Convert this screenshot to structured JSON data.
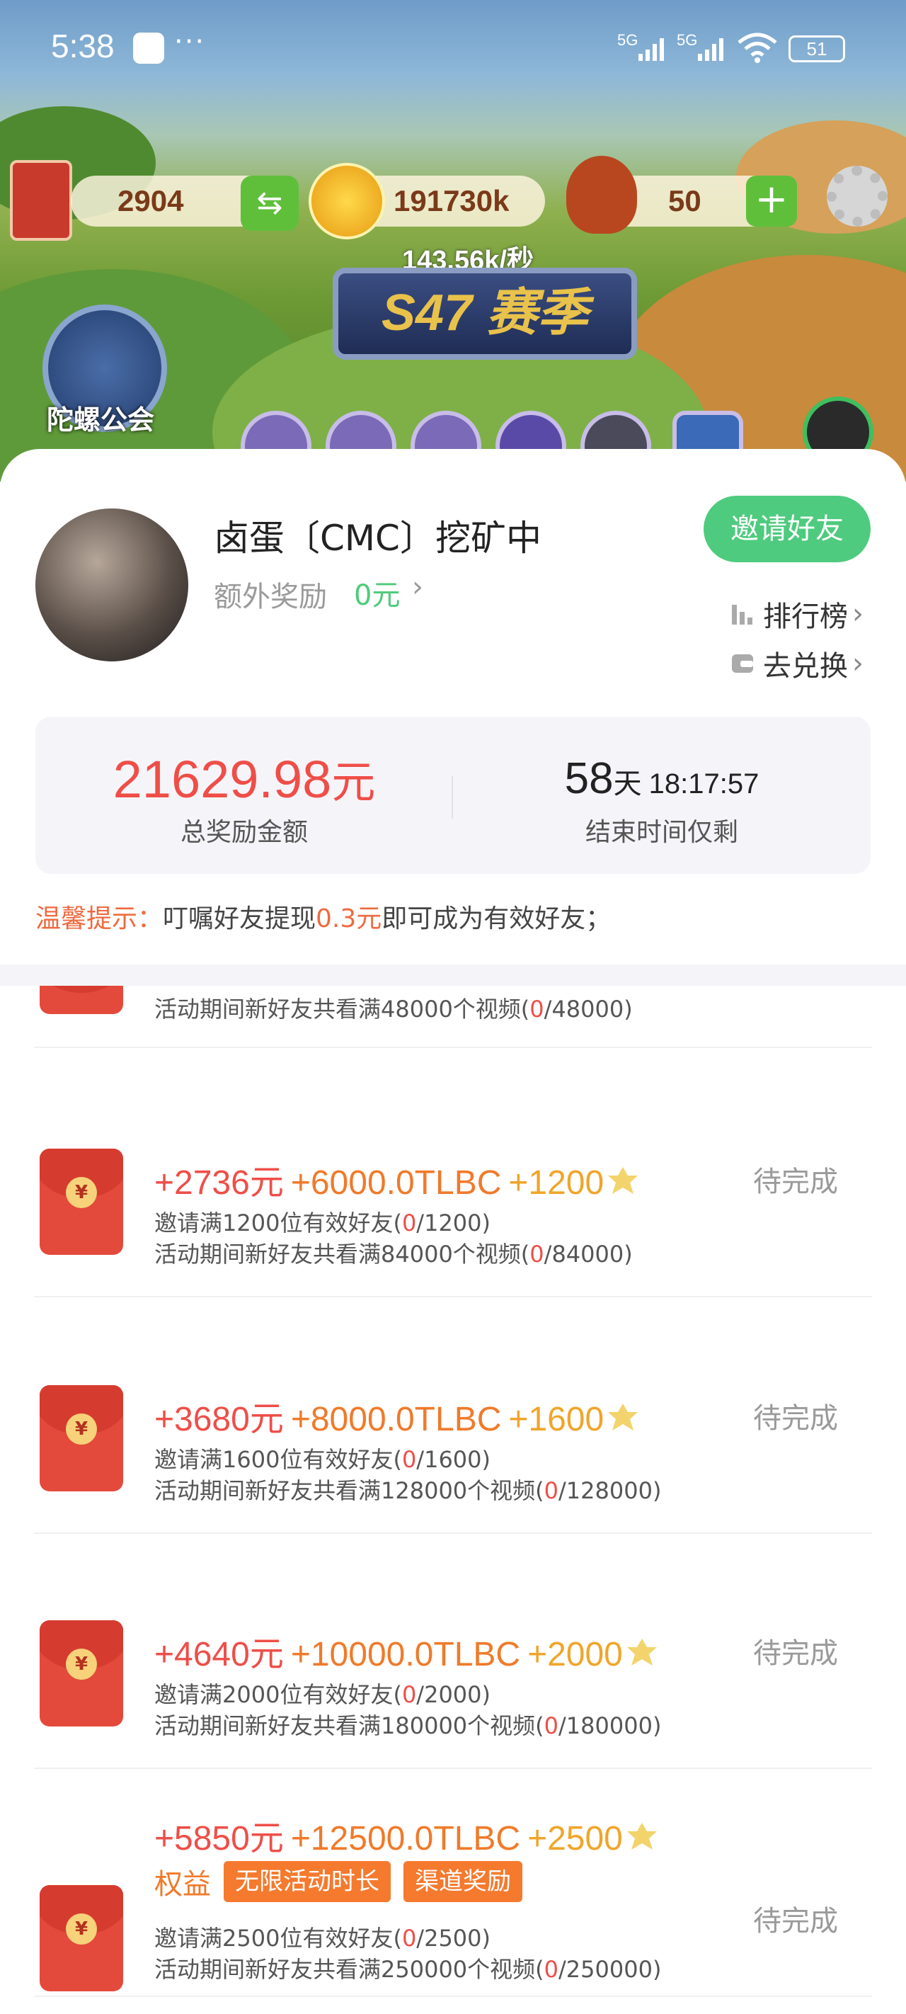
{
  "status_bar": {
    "time": "5:38",
    "dots": "···",
    "net1": "5G",
    "net2": "5G",
    "battery": "51"
  },
  "game": {
    "res_ticket": "2904",
    "res_gold": "191730k",
    "res_meat": "50",
    "rate": "143.56k/秒",
    "season": "S47 赛季",
    "guild": "陀螺公会"
  },
  "user": {
    "name": "卤蛋〔CMC〕挖矿中",
    "bonus_label": "额外奖励",
    "bonus_value": "0元"
  },
  "actions": {
    "invite": "邀请好友",
    "ranking": "排行榜",
    "exchange": "去兑换"
  },
  "stats": {
    "total_value": "21629.98",
    "total_unit": "元",
    "total_label": "总奖励金额",
    "remain_days": "58",
    "remain_days_unit": "天",
    "remain_time": "18:17:57",
    "remain_label": "结束时间仅剩"
  },
  "tip": {
    "head": "温馨提示：",
    "before": "叮嘱好友提现",
    "amount": "0.3元",
    "after": "即可成为有效好友；"
  },
  "tasks": [
    {
      "cond2": "活动期间新好友共看满48000个视频(",
      "cond2_num": "0",
      "cond2_end": "/48000)"
    },
    {
      "yuan": "+2736元",
      "tlbc": "+6000.0TLBC",
      "coins": "+1200",
      "cond1": "邀请满1200位有效好友(",
      "cond1_num": "0",
      "cond1_end": "/1200)",
      "cond2": "活动期间新好友共看满84000个视频(",
      "cond2_num": "0",
      "cond2_end": "/84000)",
      "status": "待完成"
    },
    {
      "yuan": "+3680元",
      "tlbc": "+8000.0TLBC",
      "coins": "+1600",
      "cond1": "邀请满1600位有效好友(",
      "cond1_num": "0",
      "cond1_end": "/1600)",
      "cond2": "活动期间新好友共看满128000个视频(",
      "cond2_num": "0",
      "cond2_end": "/128000)",
      "status": "待完成"
    },
    {
      "yuan": "+4640元",
      "tlbc": "+10000.0TLBC",
      "coins": "+2000",
      "cond1": "邀请满2000位有效好友(",
      "cond1_num": "0",
      "cond1_end": "/2000)",
      "cond2": "活动期间新好友共看满180000个视频(",
      "cond2_num": "0",
      "cond2_end": "/180000)",
      "status": "待完成"
    },
    {
      "yuan": "+5850元",
      "tlbc": "+12500.0TLBC",
      "coins": "+2500",
      "perk_label": "权益",
      "tag1": "无限活动时长",
      "tag2": "渠道奖励",
      "cond1": "邀请满2500位有效好友(",
      "cond1_num": "0",
      "cond1_end": "/2500)",
      "cond2": "活动期间新好友共看满250000个视频(",
      "cond2_num": "0",
      "cond2_end": "/250000)",
      "status": "待完成"
    }
  ],
  "colors": {
    "accent_green": "#4ecb7e",
    "red": "#ef4e48",
    "orange": "#f07a2a",
    "gold": "#f0a52a"
  }
}
